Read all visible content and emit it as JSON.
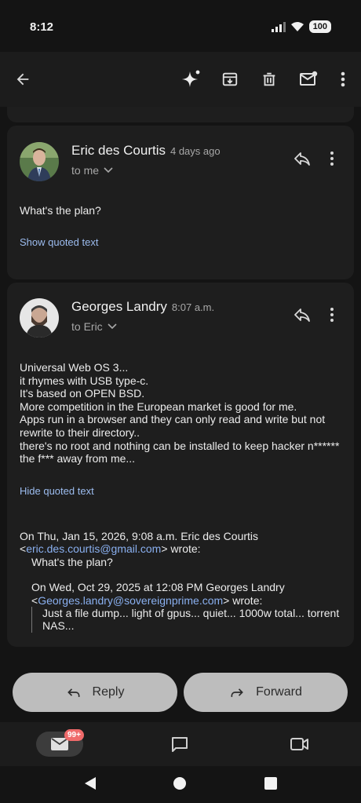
{
  "status": {
    "time": "8:12",
    "battery": "100"
  },
  "app_bar": {
    "icons": [
      "back-arrow-icon",
      "sparkle-icon",
      "archive-icon",
      "delete-icon",
      "mark-unread-icon",
      "more-vert-icon"
    ]
  },
  "messages": [
    {
      "sender": "Eric des Courtis",
      "time": "4 days ago",
      "recipient": "to me",
      "body": "What's the plan?",
      "quoted_toggle": "Show quoted text"
    },
    {
      "sender": "Georges Landry",
      "time": "8:07 a.m.",
      "recipient": "to Eric",
      "body": "Universal Web OS 3...\nit rhymes with USB type-c.\nIt's based on OPEN BSD.\nMore competition in the European market is good for me.\nApps run in a browser and they can only read and write but not rewrite to their directory..\nthere's no root and nothing can be installed to keep hacker n****** the f*** away from me...",
      "quoted_toggle": "Hide quoted text",
      "quoted": {
        "line1_prefix": "On Thu, Jan 15, 2026, 9:08 a.m. Eric des Courtis",
        "line1_email": "eric.des.courtis@gmail.com",
        "line1_suffix": "wrote:",
        "reply_text": "What's the plan?",
        "line2_prefix": "On Wed, Oct 29, 2025 at 12:08 PM Georges Landry",
        "line2_email": "Georges.landry@sovereignprime.com",
        "line2_suffix": "wrote:",
        "nested_text": "Just a file dump... light of gpus... quiet... 1000w total... torrent NAS..."
      }
    }
  ],
  "actions": {
    "reply": "Reply",
    "forward": "Forward"
  },
  "bottom_nav": {
    "mail_badge": "99+"
  },
  "colors": {
    "accent_link": "#9cbcef",
    "badge": "#ef6a6a",
    "button_bg": "#bdbdbd"
  }
}
